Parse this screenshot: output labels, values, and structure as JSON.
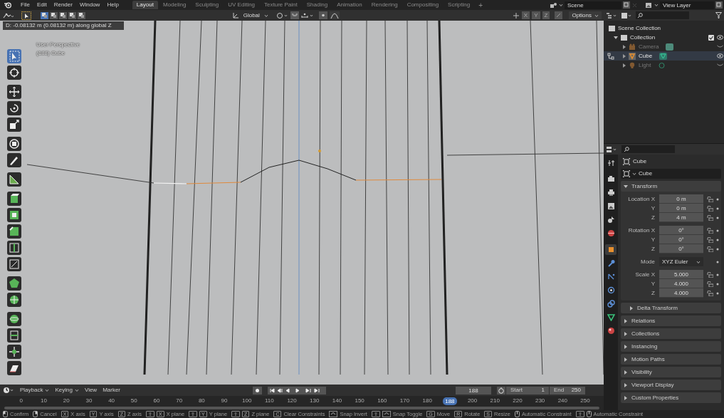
{
  "top_bar": {
    "menus": [
      "File",
      "Edit",
      "Render",
      "Window",
      "Help"
    ],
    "workspaces": [
      {
        "label": "Layout",
        "selected": true
      },
      {
        "label": "Modeling",
        "selected": false
      },
      {
        "label": "Sculpting",
        "selected": false
      },
      {
        "label": "UV Editing",
        "selected": false
      },
      {
        "label": "Texture Paint",
        "selected": false
      },
      {
        "label": "Shading",
        "selected": false
      },
      {
        "label": "Animation",
        "selected": false
      },
      {
        "label": "Rendering",
        "selected": false
      },
      {
        "label": "Compositing",
        "selected": false
      },
      {
        "label": "Scripting",
        "selected": false
      }
    ],
    "add_workspace": "+",
    "scene": "Scene",
    "view_layer": "View Layer"
  },
  "viewport_header": {
    "select_modes": [
      {
        "selected": true
      },
      {
        "selected": false
      },
      {
        "selected": false
      },
      {
        "selected": false
      },
      {
        "selected": false
      }
    ],
    "orientation": "Global",
    "axes": [
      {
        "label": "X",
        "on": false
      },
      {
        "label": "Y",
        "on": false
      },
      {
        "label": "Z",
        "on": false
      }
    ],
    "options": "Options"
  },
  "viewport": {
    "operator_info": "D: -0.08132 m (0.08132 m) along global Z",
    "view_name": "User Perspective",
    "object_info": "(188) Cube"
  },
  "toolbar": {
    "tools": [
      {
        "selected": true
      },
      {
        "selected": false
      },
      {
        "selected": false
      },
      {
        "selected": false
      },
      {
        "selected": false
      },
      {
        "selected": false
      },
      {
        "selected": false
      },
      {
        "selected": false
      },
      {
        "selected": false
      },
      {
        "selected": false
      },
      {
        "selected": false
      },
      {
        "selected": false
      },
      {
        "selected": false
      },
      {
        "selected": false
      },
      {
        "selected": false
      },
      {
        "selected": false
      },
      {
        "selected": false
      },
      {
        "selected": false
      },
      {
        "selected": false
      }
    ]
  },
  "outliner": {
    "scene_collection": "Scene Collection",
    "collection": {
      "label": "Collection",
      "expanded": true,
      "checked": true,
      "children": [
        {
          "label": "Camera",
          "kind": "camera",
          "selected": false,
          "visible": false
        },
        {
          "label": "Cube",
          "kind": "mesh",
          "selected": true,
          "visible": true
        },
        {
          "label": "Light",
          "kind": "light",
          "selected": false,
          "visible": false
        }
      ]
    }
  },
  "properties": {
    "tabs": [
      {
        "selected": false
      },
      {
        "selected": false
      },
      {
        "selected": false
      },
      {
        "selected": false
      },
      {
        "selected": false
      },
      {
        "selected": false
      },
      {
        "selected": true
      },
      {
        "selected": false
      },
      {
        "selected": false
      },
      {
        "selected": false
      },
      {
        "selected": false
      },
      {
        "selected": false
      },
      {
        "selected": false
      }
    ],
    "object_name": "Cube",
    "data_name": "Cube",
    "transform": {
      "title": "Transform",
      "expanded": true,
      "groups": [
        {
          "rows": [
            {
              "label": "Location X",
              "value": "0 m",
              "kind": "number"
            },
            {
              "label": "Y",
              "value": "0 m",
              "kind": "number"
            },
            {
              "label": "Z",
              "value": "4 m",
              "kind": "number"
            }
          ]
        },
        {
          "rows": [
            {
              "label": "Rotation X",
              "value": "0°",
              "kind": "number"
            },
            {
              "label": "Y",
              "value": "0°",
              "kind": "number"
            },
            {
              "label": "Z",
              "value": "0°",
              "kind": "number"
            }
          ]
        },
        {
          "rows": [
            {
              "label": "Mode",
              "value": "XYZ Euler",
              "kind": "dropdown"
            }
          ]
        },
        {
          "rows": [
            {
              "label": "Scale X",
              "value": "5.000",
              "kind": "number"
            },
            {
              "label": "Y",
              "value": "4.000",
              "kind": "number"
            },
            {
              "label": "Z",
              "value": "4.000",
              "kind": "number"
            }
          ]
        }
      ],
      "sub_panel": {
        "title": "Delta Transform",
        "expanded": false
      }
    },
    "panels": [
      {
        "title": "Relations",
        "expanded": false
      },
      {
        "title": "Collections",
        "expanded": false
      },
      {
        "title": "Instancing",
        "expanded": false
      },
      {
        "title": "Motion Paths",
        "expanded": false
      },
      {
        "title": "Visibility",
        "expanded": false
      },
      {
        "title": "Viewport Display",
        "expanded": false
      },
      {
        "title": "Custom Properties",
        "expanded": false
      }
    ]
  },
  "timeline": {
    "menus": [
      {
        "label": "Playback",
        "kind": "dropdown"
      },
      {
        "label": "Keying",
        "kind": "dropdown"
      },
      {
        "label": "View",
        "kind": "menu"
      },
      {
        "label": "Marker",
        "kind": "menu"
      }
    ],
    "current_frame": "188",
    "start_label": "Start",
    "start": "1",
    "end_label": "End",
    "end": "250",
    "ticks_before": [
      "0",
      "10",
      "20",
      "30",
      "40",
      "50",
      "60",
      "70",
      "80",
      "90",
      "100",
      "110",
      "120",
      "130",
      "140",
      "150",
      "160",
      "170",
      "180"
    ],
    "current_marker": "188",
    "ticks_after": [
      "200",
      "210",
      "220",
      "230",
      "240",
      "250"
    ]
  },
  "status_bar": {
    "items": [
      {
        "kind": "mouse-left",
        "label": "Confirm"
      },
      {
        "kind": "mouse-right",
        "label": "Cancel"
      },
      {
        "kind": "keys",
        "keys": [
          "X"
        ],
        "label": "X axis"
      },
      {
        "kind": "keys",
        "keys": [
          "Y"
        ],
        "label": "Y axis"
      },
      {
        "kind": "keys",
        "keys": [
          "Z"
        ],
        "label": "Z axis"
      },
      {
        "kind": "keys",
        "keys": [
          "⇧",
          "X"
        ],
        "label": "X plane"
      },
      {
        "kind": "keys",
        "keys": [
          "⇧",
          "Y"
        ],
        "label": "Y plane"
      },
      {
        "kind": "keys",
        "keys": [
          "⇧",
          "Z"
        ],
        "label": "Z plane"
      },
      {
        "kind": "keys",
        "keys": [
          "C"
        ],
        "label": "Clear Constraints"
      },
      {
        "kind": "ctrl",
        "label": "Snap Invert"
      },
      {
        "kind": "keys-ctrl",
        "keys": [
          "⇧"
        ],
        "label": "Snap Toggle"
      },
      {
        "kind": "keys",
        "keys": [
          "G"
        ],
        "label": "Move"
      },
      {
        "kind": "keys",
        "keys": [
          "R"
        ],
        "label": "Rotate"
      },
      {
        "kind": "keys",
        "keys": [
          "S"
        ],
        "label": "Resize"
      },
      {
        "kind": "mouse-middle",
        "label": "Automatic Constraint"
      },
      {
        "kind": "keys-middle",
        "keys": [
          "⇧"
        ],
        "label": "Automatic Constraint"
      }
    ]
  }
}
